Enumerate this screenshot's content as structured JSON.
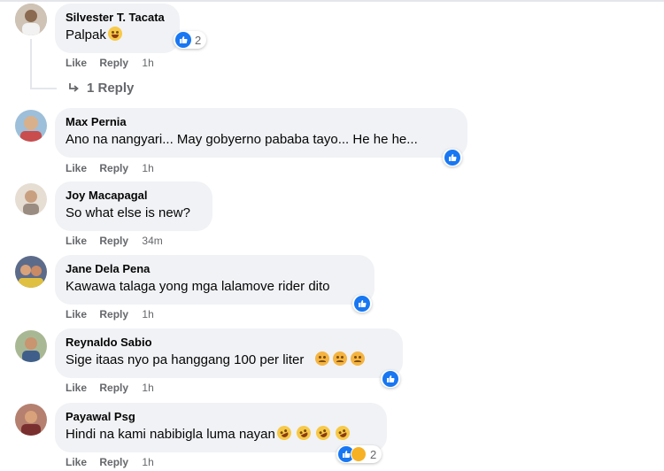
{
  "comments": [
    {
      "name": "Silvester T. Tacata",
      "text": "Palpak",
      "actions": {
        "like": "Like",
        "reply": "Reply",
        "time": "1h"
      },
      "reactions": {
        "count": "2"
      },
      "view_replies": "1 Reply",
      "avatar_color": "#b8a89a"
    },
    {
      "name": "Max Pernia",
      "text": "Ano na nangyari... May gobyerno pababa tayo... He he he...",
      "actions": {
        "like": "Like",
        "reply": "Reply",
        "time": "1h"
      },
      "avatar_color": "#7fa9c9"
    },
    {
      "name": "Joy Macapagal",
      "text": "So what else is new?",
      "actions": {
        "like": "Like",
        "reply": "Reply",
        "time": "34m"
      },
      "avatar_color": "#c9b9aa"
    },
    {
      "name": "Jane Dela Pena",
      "text": "Kawawa talaga yong mga lalamove rider dito",
      "actions": {
        "like": "Like",
        "reply": "Reply",
        "time": "1h"
      },
      "avatar_color": "#6a5a6e"
    },
    {
      "name": "Reynaldo Sabio",
      "text": "Sige itaas nyo pa hanggang 100 per liter",
      "actions": {
        "like": "Like",
        "reply": "Reply",
        "time": "1h"
      },
      "avatar_color": "#8c9a7a"
    },
    {
      "name": "Payawal Psg",
      "text": "Hindi na kami nabibigla luma nayan",
      "actions": {
        "like": "Like",
        "reply": "Reply",
        "time": "1h"
      },
      "reactions": {
        "count": "2"
      },
      "avatar_color": "#a3695a"
    }
  ],
  "colors": {
    "bubble": "#f0f2f5",
    "like_blue": "#1877f2",
    "meta_gray": "#65676b"
  }
}
